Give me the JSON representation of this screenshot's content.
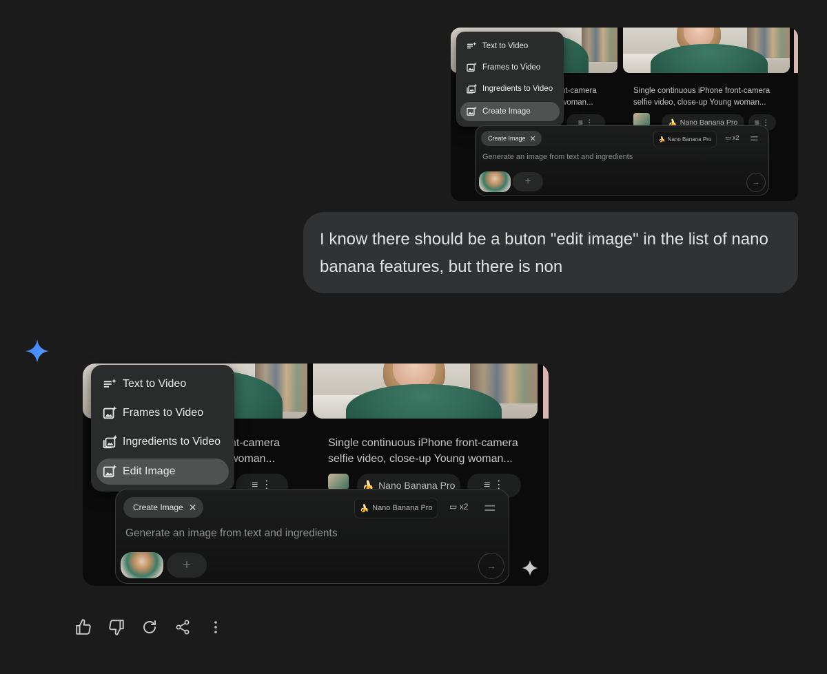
{
  "top_screenshot": {
    "menu": [
      {
        "label": "Text to Video",
        "icon": "text-sparkle-icon",
        "selected": false
      },
      {
        "label": "Frames to Video",
        "icon": "image-sparkle-icon",
        "selected": false
      },
      {
        "label": "Ingredients to Video",
        "icon": "layers-sparkle-icon",
        "selected": false
      },
      {
        "label": "Create Image",
        "icon": "image-sparkle-icon",
        "selected": true
      }
    ],
    "card_left_text": "nt-camera\nwoman...",
    "card_right_text": "Single continuous iPhone front-camera\nselfie video, close-up Young woman...",
    "card_model": "Nano Banana Pro",
    "prompt": {
      "chip_label": "Create Image",
      "model_label": "Nano Banana Pro",
      "count_label": "x2",
      "placeholder": "Generate an image from text and ingredients"
    }
  },
  "user_message": "I know there should be a buton \"edit image\" in the list of nano banana features, but there is non",
  "bottom_screenshot": {
    "menu": [
      {
        "label": "Text to Video",
        "icon": "text-sparkle-icon",
        "selected": false
      },
      {
        "label": "Frames to Video",
        "icon": "image-sparkle-icon",
        "selected": false
      },
      {
        "label": "Ingredients to Video",
        "icon": "layers-sparkle-icon",
        "selected": false
      },
      {
        "label": "Edit Image",
        "icon": "image-sparkle-icon",
        "selected": true
      }
    ],
    "card_left_text": "nt-camera\nwoman...",
    "card_right_text": "Single continuous iPhone front-camera\nselfie video, close-up Young woman...",
    "card_model": "Nano Banana Pro",
    "prompt": {
      "chip_label": "Create Image",
      "model_label": "Nano Banana Pro",
      "count_label": "x2",
      "placeholder": "Generate an image from text and ingredients"
    }
  },
  "actions": [
    {
      "name": "thumbs-up-icon"
    },
    {
      "name": "thumbs-down-icon"
    },
    {
      "name": "redo-icon"
    },
    {
      "name": "share-icon"
    },
    {
      "name": "more-vert-icon"
    }
  ],
  "colors": {
    "background": "#1b1b1b",
    "bubble": "#303233",
    "gemini_star": "#4285f4",
    "menu_bg": "#2a2c2b",
    "menu_selected": "#505251"
  }
}
